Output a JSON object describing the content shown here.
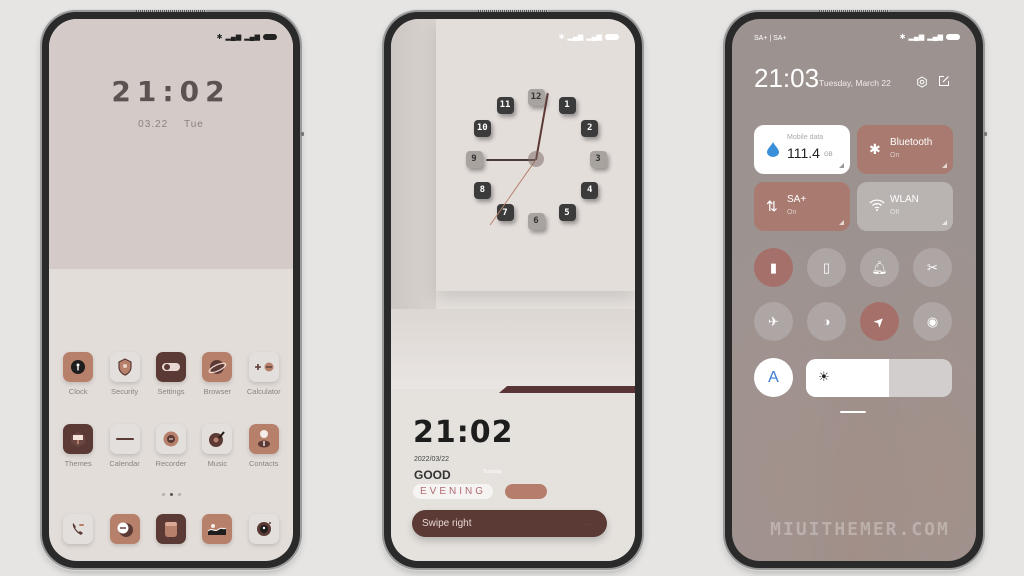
{
  "status_icons": [
    "bluetooth-icon",
    "sim-icon",
    "signal-icon",
    "sim-icon",
    "signal-icon",
    "battery-icon"
  ],
  "phone1": {
    "time": "21:02",
    "date": "03.22",
    "weekday": "Tue",
    "apps_row1": [
      {
        "label": "Clock",
        "icon": "clock-icon",
        "color": "tan"
      },
      {
        "label": "Security",
        "icon": "shield-icon",
        "color": "light"
      },
      {
        "label": "Settings",
        "icon": "toggle-icon",
        "color": "dark"
      },
      {
        "label": "Browser",
        "icon": "planet-icon",
        "color": "tan"
      },
      {
        "label": "Calculator",
        "icon": "calculator-icon",
        "color": "light"
      }
    ],
    "apps_row2": [
      {
        "label": "Themes",
        "icon": "paintbrush-icon",
        "color": "dark"
      },
      {
        "label": "Calendar",
        "icon": "calendar-icon",
        "color": "light"
      },
      {
        "label": "Recorder",
        "icon": "record-icon",
        "color": "light"
      },
      {
        "label": "Music",
        "icon": "vinyl-icon",
        "color": "light"
      },
      {
        "label": "Contacts",
        "icon": "person-icon",
        "color": "tan"
      }
    ],
    "page_count": 3,
    "active_page": 2,
    "dock": [
      {
        "icon": "phone-icon",
        "color": "light"
      },
      {
        "icon": "message-icon",
        "color": "tan"
      },
      {
        "icon": "notes-icon",
        "color": "dark"
      },
      {
        "icon": "gallery-icon",
        "color": "tan"
      },
      {
        "icon": "camera-icon",
        "color": "light"
      }
    ]
  },
  "phone2": {
    "clock_numbers": [
      "12",
      "1",
      "2",
      "3",
      "4",
      "5",
      "6",
      "7",
      "8",
      "9",
      "10",
      "11"
    ],
    "time": "21:02",
    "date": "2022/03/22",
    "greeting_top": "GOOD",
    "greeting_word": "EVENING",
    "faint_day": "Tuesday",
    "swipe_label": "Swipe right",
    "swipe_arrow": "→"
  },
  "phone3": {
    "carrier": "SA+ | SA+",
    "time": "21:03",
    "date": "Tuesday, March 22",
    "tiles": {
      "mobile_data": {
        "label": "Mobile data",
        "value": "111.4",
        "unit": "GB"
      },
      "bluetooth": {
        "label": "Bluetooth",
        "state": "On"
      },
      "sa": {
        "label": "SA+",
        "state": "On"
      },
      "wlan": {
        "label": "WLAN",
        "state": "Off"
      }
    },
    "toggles_row1": [
      {
        "icon": "vibrate-icon",
        "active": true
      },
      {
        "icon": "flashlight-icon",
        "active": false
      },
      {
        "icon": "bell-icon",
        "active": false
      },
      {
        "icon": "screenshot-icon",
        "active": false
      }
    ],
    "toggles_row2": [
      {
        "icon": "airplane-icon",
        "active": false
      },
      {
        "icon": "dark-mode-icon",
        "active": false
      },
      {
        "icon": "location-icon",
        "active": true
      },
      {
        "icon": "eye-icon",
        "active": false
      }
    ],
    "auto_brightness_label": "A",
    "brightness_percent": 57,
    "watermark": "MIUITHEMER.COM"
  },
  "colors": {
    "accent_tan": "#b7806b",
    "accent_dark": "#5b3a36",
    "cc_active": "#a6706a",
    "mobile_data_drop": "#3a8fd9"
  }
}
